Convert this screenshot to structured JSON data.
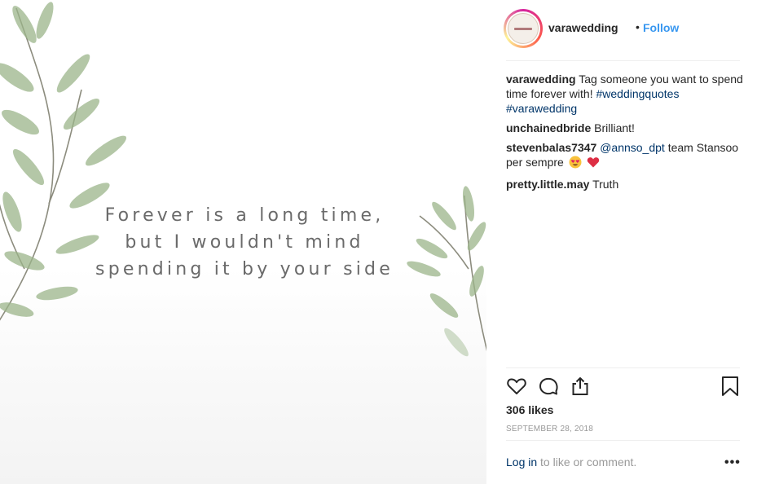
{
  "post": {
    "quote_lines": [
      "Forever is a long time,",
      "but I wouldn't mind",
      "spending it by your side"
    ]
  },
  "header": {
    "username": "varawedding",
    "separator": "•",
    "follow_label": "Follow"
  },
  "caption": {
    "user": "varawedding",
    "text": "Tag someone you want to spend time forever with!",
    "hashtags": [
      "#weddingquotes",
      "#varawedding"
    ]
  },
  "comments": [
    {
      "user": "unchainedbride",
      "text": "Brilliant!"
    },
    {
      "user": "stevenbalas7347",
      "mention": "@annso_dpt",
      "text": "team Stansoo per sempre"
    },
    {
      "user": "pretty.little.may",
      "text": "Truth"
    }
  ],
  "stats": {
    "likes": "306 likes",
    "date": "SEPTEMBER 28, 2018"
  },
  "footer": {
    "login_link": "Log in",
    "login_text": "to like or comment.",
    "more_label": "•••"
  },
  "icons": [
    "heart-icon",
    "comment-icon",
    "share-icon",
    "bookmark-icon",
    "more-options-icon"
  ],
  "colors": {
    "follow": "#3897f0",
    "link": "#003569",
    "muted": "#999999"
  }
}
